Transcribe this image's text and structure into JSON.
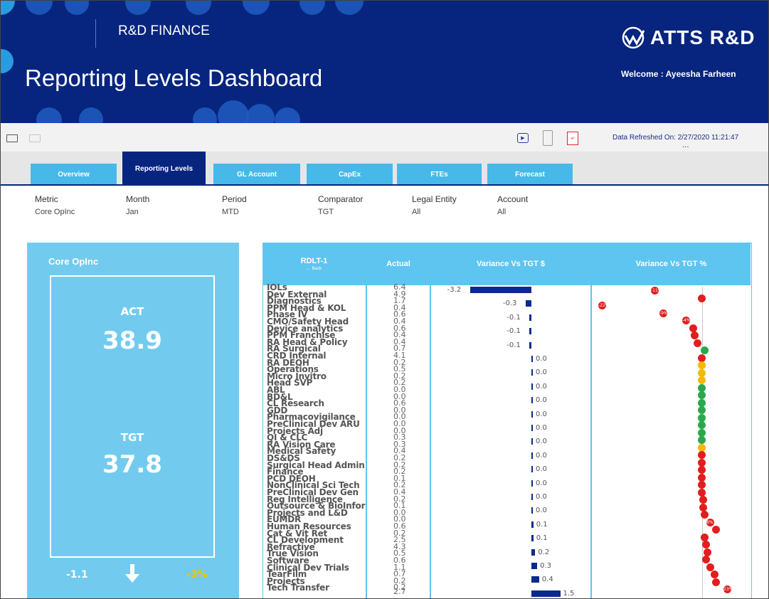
{
  "header": {
    "section": "R&D FINANCE",
    "title": "Reporting Levels Dashboard",
    "logo_text": "ATTS R&D",
    "welcome": "Welcome : Ayeesha Farheen"
  },
  "toolbar": {
    "icons": [
      "laptop-icon",
      "tablet-icon",
      "present-icon",
      "mobile-icon",
      "pdf-icon"
    ],
    "refreshed": "Data Refreshed On: 2/27/2020 11:21:47",
    "more": "..."
  },
  "tabs": [
    {
      "label": "Overview",
      "active": false
    },
    {
      "label": "Reporting Levels",
      "active": true
    },
    {
      "label": "GL Account",
      "active": false
    },
    {
      "label": "CapEx",
      "active": false
    },
    {
      "label": "FTEs",
      "active": false
    },
    {
      "label": "Forecast",
      "active": false
    }
  ],
  "filters": [
    {
      "label": "Metric",
      "value": "Core OpInc"
    },
    {
      "label": "Month",
      "value": "Jan"
    },
    {
      "label": "Period",
      "value": "MTD"
    },
    {
      "label": "Comparator",
      "value": "TGT"
    },
    {
      "label": "Legal Entity",
      "value": "All"
    },
    {
      "label": "Account",
      "value": "All"
    }
  ],
  "kpi": {
    "title": "Core OpInc",
    "act_label": "ACT",
    "act_value": "38.9",
    "tgt_label": "TGT",
    "tgt_value": "37.8",
    "variance": "-1.1",
    "variance_pct": "-3%",
    "arrow": "down-arrow-icon"
  },
  "grid": {
    "headers": [
      "RDLT-1",
      "Actual",
      "Variance Vs TGT $",
      "Variance Vs TGT %"
    ],
    "back_label": "Back",
    "rows": [
      {
        "name": "IOLs",
        "actual": "6.4"
      },
      {
        "name": "Dev External",
        "actual": "4.9"
      },
      {
        "name": "Diagnostics",
        "actual": "1.7"
      },
      {
        "name": "PPM Head & KOL",
        "actual": "0.4"
      },
      {
        "name": "Phase IV",
        "actual": "0.6"
      },
      {
        "name": "CMO/Safety Head",
        "actual": "0.4"
      },
      {
        "name": "Device analytics",
        "actual": "0.6"
      },
      {
        "name": "PPM Franchise",
        "actual": "0.4"
      },
      {
        "name": "RA Head & Policy",
        "actual": "0.4"
      },
      {
        "name": "RA Surgical",
        "actual": "0.7"
      },
      {
        "name": "CRD Internal",
        "actual": "4.1"
      },
      {
        "name": "RA DEOH",
        "actual": "0.2"
      },
      {
        "name": "Operations",
        "actual": "0.5"
      },
      {
        "name": "Micro Invitro",
        "actual": "0.2"
      },
      {
        "name": "Head SVP",
        "actual": "0.2"
      },
      {
        "name": "ABL",
        "actual": "0.0"
      },
      {
        "name": "BD&L",
        "actual": "0.0"
      },
      {
        "name": "CL Research",
        "actual": "0.6"
      },
      {
        "name": "GDD",
        "actual": "0.0"
      },
      {
        "name": "Pharmacovigilance",
        "actual": "0.0"
      },
      {
        "name": "PreClinical Dev ARU",
        "actual": "0.0"
      },
      {
        "name": "Projects Adj",
        "actual": "0.0"
      },
      {
        "name": "QI & CLC",
        "actual": "0.3"
      },
      {
        "name": "RA Vision Care",
        "actual": "0.3"
      },
      {
        "name": "Medical Safety",
        "actual": "0.4"
      },
      {
        "name": "DS&DS",
        "actual": "0.2"
      },
      {
        "name": "Surgical Head Admin",
        "actual": "0.2"
      },
      {
        "name": "Finance",
        "actual": "0.2"
      },
      {
        "name": "PCD DEOH",
        "actual": "0.1"
      },
      {
        "name": "NonClinical Sci Tech",
        "actual": "0.2"
      },
      {
        "name": "PreClinical Dev Gen",
        "actual": "0.4"
      },
      {
        "name": "Reg Intelligence",
        "actual": "0.2"
      },
      {
        "name": "Outsource & BioInfor",
        "actual": "0.1"
      },
      {
        "name": "Projects and L&D",
        "actual": "0.0"
      },
      {
        "name": "EUMDR",
        "actual": "0.0"
      },
      {
        "name": "Human Resources",
        "actual": "0.6"
      },
      {
        "name": "Cat & Vit Ret",
        "actual": "0.2"
      },
      {
        "name": "CL Development",
        "actual": "2.5"
      },
      {
        "name": "Refractive",
        "actual": "4.3"
      },
      {
        "name": "True Vision",
        "actual": "0.5"
      },
      {
        "name": "Software",
        "actual": "0.6"
      },
      {
        "name": "Clinical Dev Trials",
        "actual": "1.1"
      },
      {
        "name": "TearFilm",
        "actual": "0.7"
      },
      {
        "name": "Projects",
        "actual": "0.2"
      },
      {
        "name": "Tech Transfer",
        "actual": "0.2"
      }
    ],
    "last_actual": "2.7",
    "variance_bars": [
      {
        "label": "-3.2",
        "value": -3.2
      },
      {
        "label": "-0.3",
        "value": -0.3
      },
      {
        "label": "-0.1",
        "value": -0.1
      },
      {
        "label": "-0.1",
        "value": -0.1
      },
      {
        "label": "-0.1",
        "value": -0.1
      },
      {
        "label": "0.0",
        "value": 0.0
      },
      {
        "label": "0.0",
        "value": 0.0
      },
      {
        "label": "0.0",
        "value": 0.0
      },
      {
        "label": "0.0",
        "value": 0.0
      },
      {
        "label": "0.0",
        "value": 0.0
      },
      {
        "label": "0.0",
        "value": 0.0
      },
      {
        "label": "0.0",
        "value": 0.0
      },
      {
        "label": "0.0",
        "value": 0.0
      },
      {
        "label": "0.0",
        "value": 0.0
      },
      {
        "label": "0.0",
        "value": 0.0
      },
      {
        "label": "0.0",
        "value": 0.0
      },
      {
        "label": "0.0",
        "value": 0.0
      },
      {
        "label": "0.1",
        "value": 0.1
      },
      {
        "label": "0.1",
        "value": 0.1
      },
      {
        "label": "0.2",
        "value": 0.2
      },
      {
        "label": "0.3",
        "value": 0.3
      },
      {
        "label": "0.4",
        "value": 0.4
      },
      {
        "label": "1.5",
        "value": 1.5
      }
    ],
    "pct_points": [
      {
        "color": "r",
        "label": "-11%"
      },
      {
        "color": "r",
        "label": ""
      },
      {
        "color": "r",
        "label": "-22%"
      },
      {
        "color": "r",
        "label": "-9%"
      },
      {
        "color": "r",
        "label": "-4%"
      },
      {
        "color": "r",
        "label": ""
      },
      {
        "color": "r",
        "label": ""
      },
      {
        "color": "r",
        "label": ""
      },
      {
        "color": "g",
        "label": ""
      },
      {
        "color": "r",
        "label": ""
      },
      {
        "color": "y",
        "label": ""
      },
      {
        "color": "y",
        "label": ""
      },
      {
        "color": "y",
        "label": ""
      },
      {
        "color": "g",
        "label": ""
      },
      {
        "color": "g",
        "label": ""
      },
      {
        "color": "g",
        "label": ""
      },
      {
        "color": "g",
        "label": ""
      },
      {
        "color": "g",
        "label": ""
      },
      {
        "color": "g",
        "label": ""
      },
      {
        "color": "g",
        "label": ""
      },
      {
        "color": "g",
        "label": ""
      },
      {
        "color": "y",
        "label": ""
      },
      {
        "color": "r",
        "label": ""
      },
      {
        "color": "r",
        "label": ""
      },
      {
        "color": "r",
        "label": ""
      },
      {
        "color": "r",
        "label": ""
      },
      {
        "color": "r",
        "label": ""
      },
      {
        "color": "r",
        "label": ""
      },
      {
        "color": "r",
        "label": ""
      },
      {
        "color": "r",
        "label": ""
      },
      {
        "color": "r",
        "label": ""
      },
      {
        "color": "r",
        "label": "8%"
      },
      {
        "color": "r",
        "label": ""
      },
      {
        "color": "r",
        "label": ""
      },
      {
        "color": "r",
        "label": ""
      },
      {
        "color": "r",
        "label": ""
      },
      {
        "color": "r",
        "label": ""
      },
      {
        "color": "r",
        "label": ""
      },
      {
        "color": "r",
        "label": ""
      },
      {
        "color": "r",
        "label": ""
      },
      {
        "color": "r",
        "label": "23%"
      }
    ]
  },
  "colors": {
    "header_bg": "#07257e",
    "tab_bg": "#46b9e8",
    "card_bg": "#72cbef",
    "bar": "#0a2a8f",
    "red": "#e01e1e",
    "green": "#2aa84a",
    "amber": "#f5b800"
  }
}
